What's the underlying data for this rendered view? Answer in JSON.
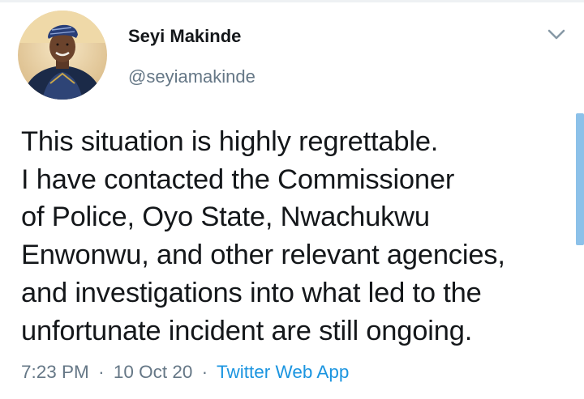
{
  "author": {
    "display_name": "Seyi Makinde",
    "handle": "@seyiamakinde"
  },
  "tweet": {
    "lines": [
      "This situation is highly regrettable.",
      "I have contacted the Commissioner",
      "of Police, Oyo State, Nwachukwu",
      "Enwonwu, and other relevant agencies,",
      "and investigations into what led to the",
      "unfortunate incident are still ongoing."
    ]
  },
  "meta": {
    "time": "7:23 PM",
    "separator": "·",
    "date": "10 Oct 20",
    "source": "Twitter Web App"
  },
  "icons": {
    "menu": "chevron-down-icon",
    "avatar": "profile-photo"
  },
  "colors": {
    "text": "#14171a",
    "secondary": "#657786",
    "link": "#1b95e0"
  }
}
